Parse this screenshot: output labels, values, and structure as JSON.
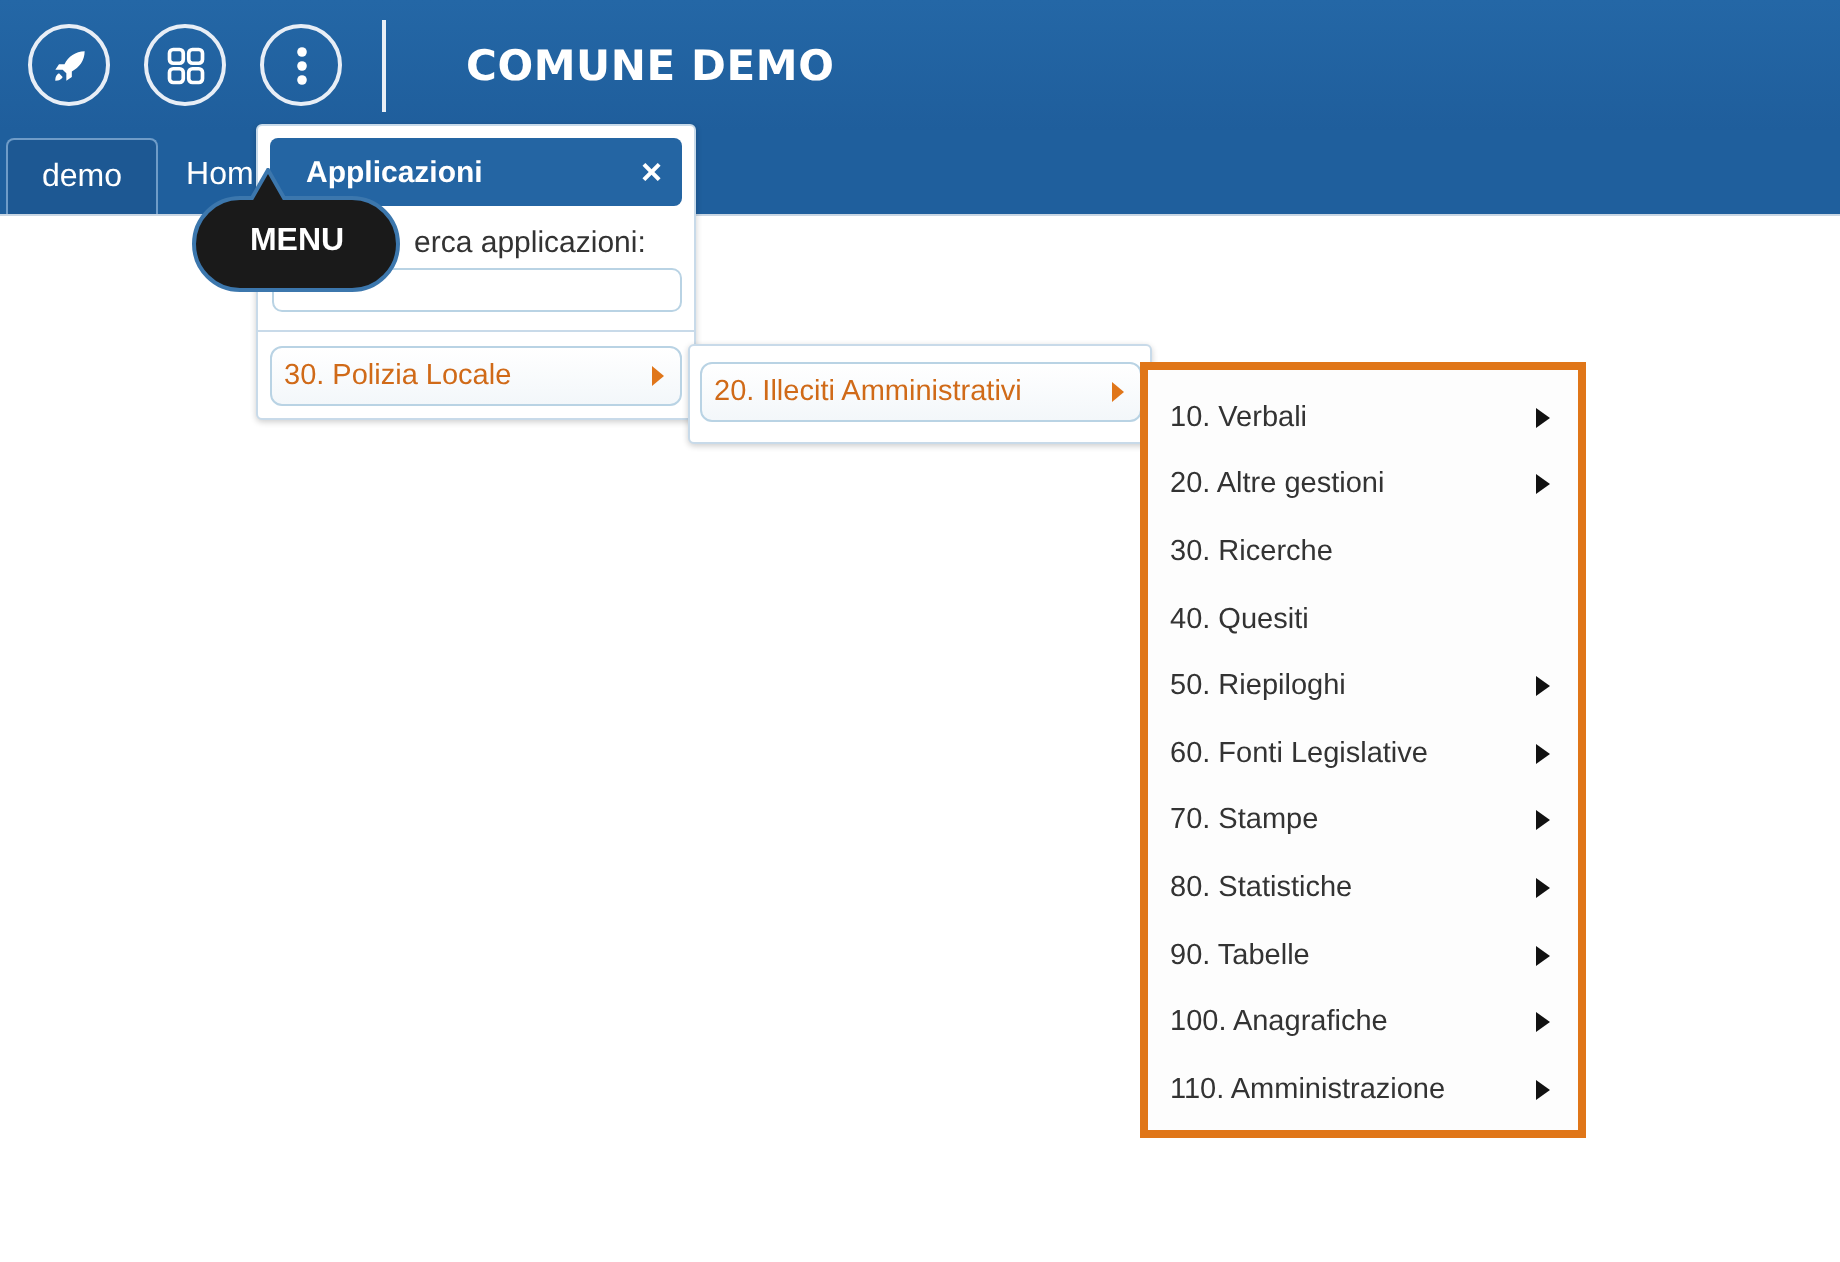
{
  "header": {
    "title": "COMUNE DEMO"
  },
  "tabs": [
    {
      "label": "demo",
      "selected": true
    },
    {
      "label": "Hom",
      "selected": false
    }
  ],
  "tooltip": {
    "text": "MENU"
  },
  "applications_panel": {
    "title": "Applicazioni",
    "close": "×",
    "search_label": "erca applicazioni:",
    "items": [
      {
        "label": "30. Polizia Locale",
        "has_submenu": true
      }
    ]
  },
  "submenu": {
    "items": [
      {
        "label": "20. Illeciti Amministrativi",
        "has_submenu": true
      }
    ]
  },
  "submenu_2": {
    "items": [
      {
        "label": "10. Verbali",
        "has_submenu": true
      },
      {
        "label": "20. Altre gestioni",
        "has_submenu": true
      },
      {
        "label": "30. Ricerche",
        "has_submenu": false
      },
      {
        "label": "40. Quesiti",
        "has_submenu": false
      },
      {
        "label": "50. Riepiloghi",
        "has_submenu": true
      },
      {
        "label": "60. Fonti Legislative",
        "has_submenu": true
      },
      {
        "label": "70. Stampe",
        "has_submenu": true
      },
      {
        "label": "80. Statistiche",
        "has_submenu": true
      },
      {
        "label": "90. Tabelle",
        "has_submenu": true
      },
      {
        "label": "100. Anagrafiche",
        "has_submenu": true
      },
      {
        "label": "110. Amministrazione",
        "has_submenu": true
      }
    ]
  }
}
